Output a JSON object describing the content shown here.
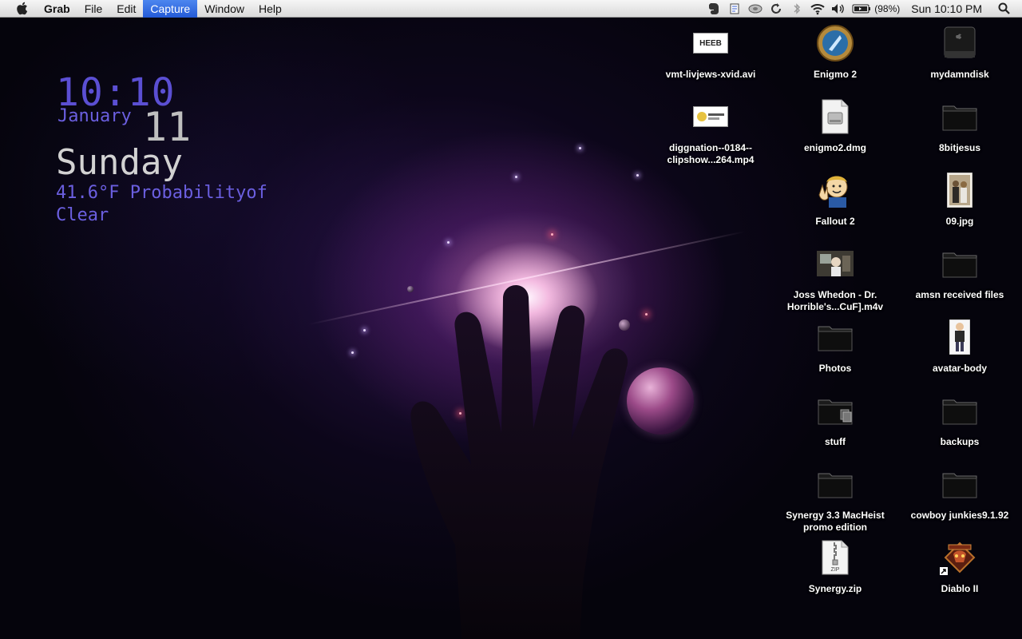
{
  "menubar": {
    "app": "Grab",
    "items": [
      "File",
      "Edit",
      "Capture",
      "Window",
      "Help"
    ],
    "active_item": "Capture",
    "battery_pct": "(98%)",
    "clock": "Sun 10:10 PM"
  },
  "widget": {
    "time": "10:10",
    "month": "January",
    "day": "11",
    "weekday": "Sunday",
    "weather_line1": "41.6°F Probabilityof",
    "weather_line2": "Clear"
  },
  "desktop": {
    "icons": {
      "vmt": {
        "line1": "vmt-livjews-xvid.avi",
        "line2": "",
        "thumb_text": "HEEB"
      },
      "diggnation": {
        "line1": "diggnation--0184--",
        "line2": "clipshow...264.mp4"
      },
      "enigmo2": {
        "line1": "Enigmo 2",
        "line2": ""
      },
      "enigmo2dmg": {
        "line1": "enigmo2.dmg",
        "line2": ""
      },
      "fallout2": {
        "line1": "Fallout 2",
        "line2": ""
      },
      "joss": {
        "line1": "Joss Whedon - Dr.",
        "line2": "Horrible's...CuF].m4v"
      },
      "photos": {
        "line1": "Photos",
        "line2": ""
      },
      "stuff": {
        "line1": "stuff",
        "line2": ""
      },
      "synergy_promo": {
        "line1": "Synergy 3.3 MacHeist",
        "line2": "promo edition"
      },
      "synergy_zip": {
        "line1": "Synergy.zip",
        "line2": "",
        "zip_text": "ZIP"
      },
      "mydamndisk": {
        "line1": "mydamndisk",
        "line2": ""
      },
      "8bitjesus": {
        "line1": "8bitjesus",
        "line2": ""
      },
      "09jpg": {
        "line1": "09.jpg",
        "line2": ""
      },
      "amsn": {
        "line1": "amsn received files",
        "line2": ""
      },
      "avatar": {
        "line1": "avatar-body",
        "line2": ""
      },
      "backups": {
        "line1": "backups",
        "line2": ""
      },
      "cowboy": {
        "line1": "cowboy junkies9.1.92",
        "line2": ""
      },
      "diablo": {
        "line1": "Diablo II",
        "line2": ""
      }
    }
  }
}
